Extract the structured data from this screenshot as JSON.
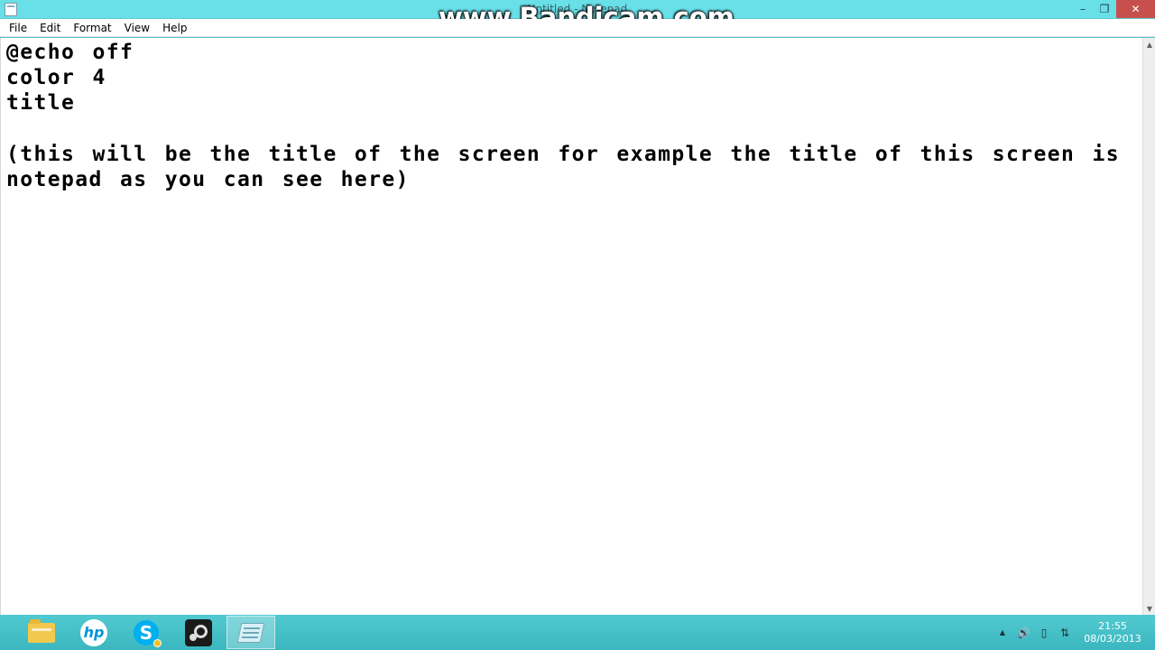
{
  "window": {
    "title": "Untitled - Notepad",
    "watermark": "www.Bandicam.com",
    "minimize_symbol": "–",
    "maximize_symbol": "❐",
    "close_symbol": "✕"
  },
  "menu": {
    "items": [
      "File",
      "Edit",
      "Format",
      "View",
      "Help"
    ]
  },
  "editor": {
    "content": "@echo off\ncolor 4\ntitle\n\n(this will be the title of the screen for example the title of this screen is\nnotepad as you can see here)"
  },
  "scrollbar": {
    "up_arrow": "▲",
    "down_arrow": "▼"
  },
  "taskbar": {
    "apps": [
      {
        "name": "file-explorer",
        "icon": "folder-icon",
        "active": false
      },
      {
        "name": "hp",
        "icon": "hp-icon",
        "label": "hp",
        "active": false
      },
      {
        "name": "skype",
        "icon": "skype-icon",
        "label": "S",
        "active": false
      },
      {
        "name": "steam",
        "icon": "steam-icon",
        "active": false
      },
      {
        "name": "notepad",
        "icon": "notepad-icon",
        "active": true
      }
    ],
    "tray": {
      "show_hidden_arrow": "▲",
      "volume_icon": "🔊",
      "battery_icon": "▯",
      "network_icon": "⇅"
    },
    "clock": {
      "time": "21:55",
      "date": "08/03/2013"
    }
  },
  "colors": {
    "titlebar": "#69dfe8",
    "taskbar": "#4cc5cc",
    "close_button": "#c7504c"
  }
}
